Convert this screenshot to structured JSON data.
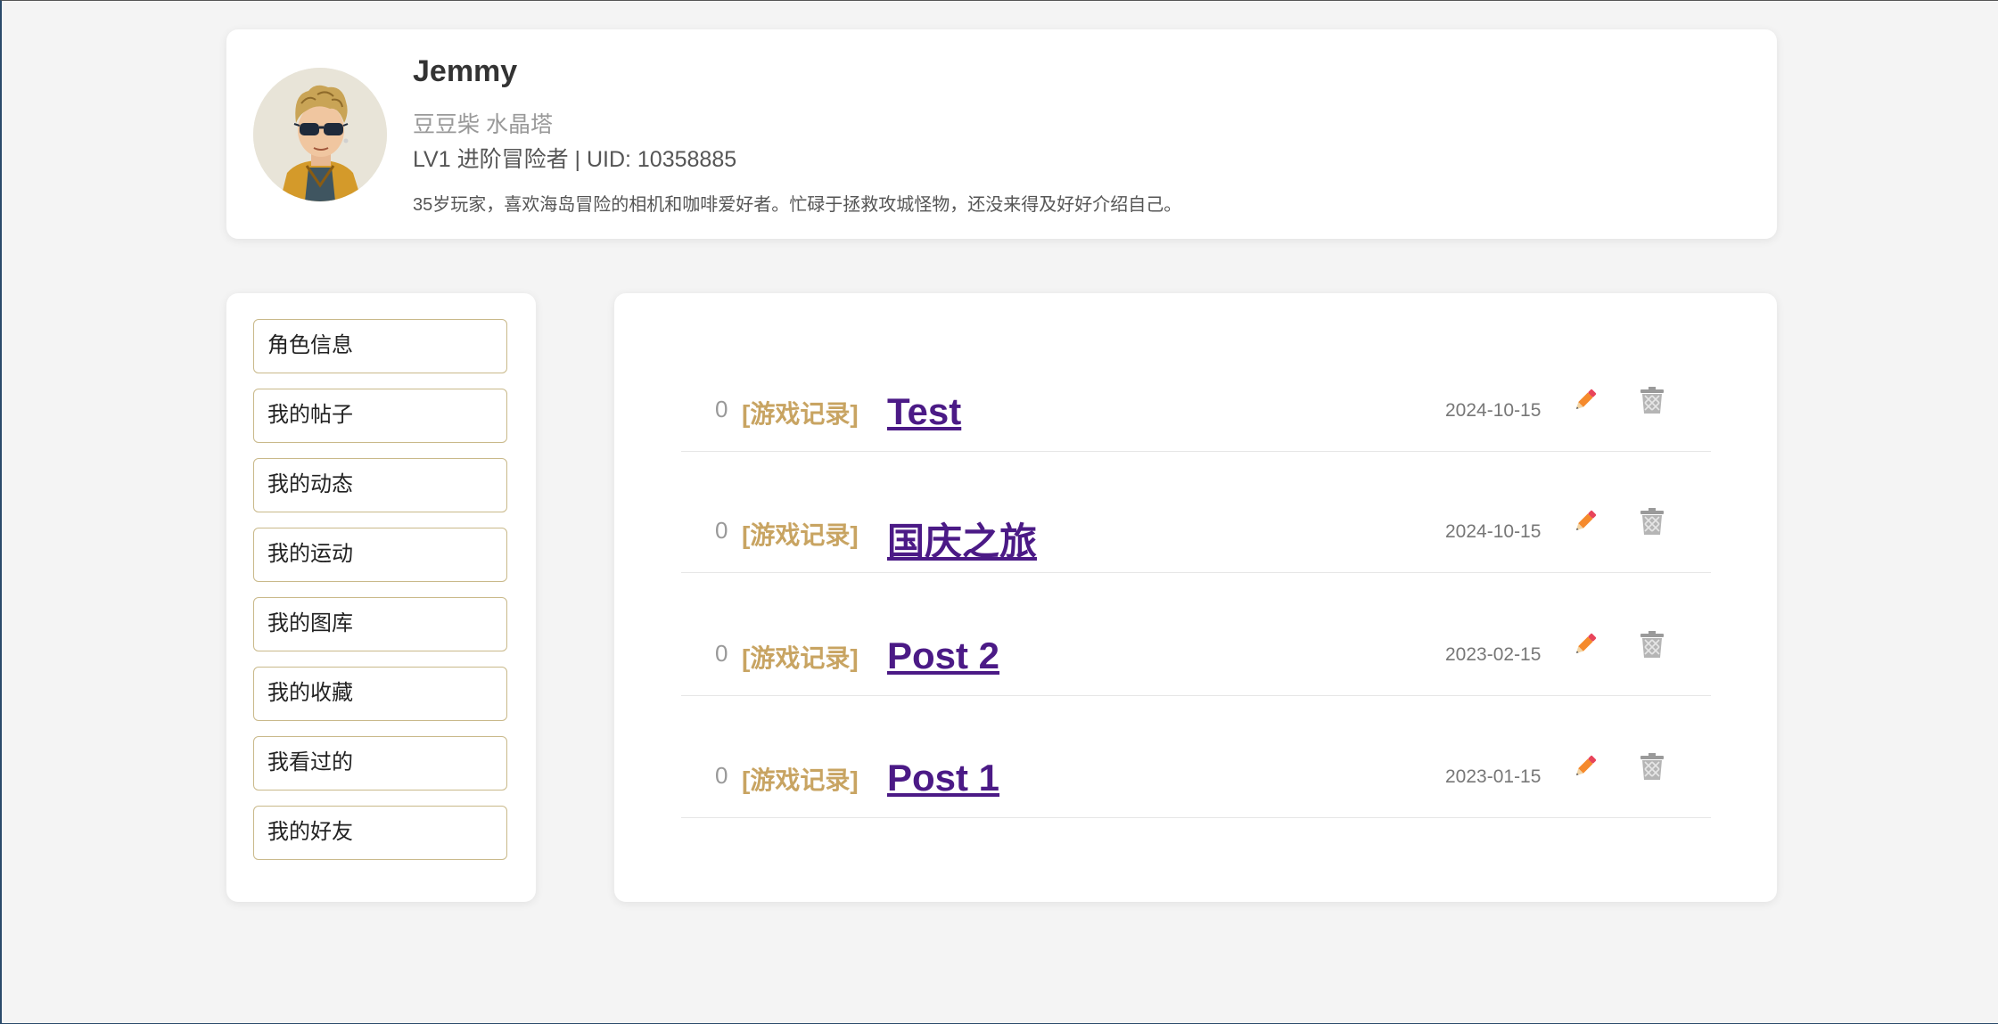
{
  "profile": {
    "name": "Jemmy",
    "alias": "豆豆柴 水晶塔",
    "level_line": "LV1 进阶冒险者 | UID: 10358885",
    "bio": "35岁玩家，喜欢海岛冒险的相机和咖啡爱好者。忙碌于拯救攻城怪物，还没来得及好好介绍自己。"
  },
  "sidebar": {
    "items": [
      {
        "label": "角色信息"
      },
      {
        "label": "我的帖子"
      },
      {
        "label": "我的动态"
      },
      {
        "label": "我的运动"
      },
      {
        "label": "我的图库"
      },
      {
        "label": "我的收藏"
      },
      {
        "label": "我看过的"
      },
      {
        "label": "我的好友"
      }
    ]
  },
  "posts": [
    {
      "count": "0",
      "tag": "[游戏记录]",
      "title": "Test",
      "date": "2024-10-15"
    },
    {
      "count": "0",
      "tag": "[游戏记录]",
      "title": "国庆之旅",
      "date": "2024-10-15"
    },
    {
      "count": "0",
      "tag": "[游戏记录]",
      "title": "Post 2",
      "date": "2023-02-15"
    },
    {
      "count": "0",
      "tag": "[游戏记录]",
      "title": "Post 1",
      "date": "2023-01-15"
    }
  ],
  "icons": {
    "edit": "pencil-icon",
    "delete": "trash-icon"
  },
  "colors": {
    "tag": "#c8a462",
    "title": "#4b1a86",
    "sidebar_border": "#c9b98a",
    "background": "#f4f4f4"
  }
}
